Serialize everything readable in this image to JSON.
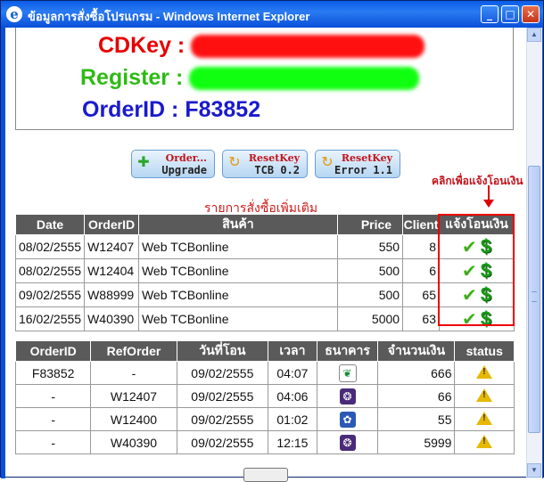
{
  "window": {
    "title": "ข้อมูลการสั่งซื้อโปรแกรม - Windows Internet Explorer"
  },
  "info": {
    "cdkey_label": "CDKey :",
    "register_label": "Register :",
    "orderid_label": "OrderID :",
    "orderid_value": "F83852"
  },
  "buttons": {
    "order_upgrade": {
      "line1": "Order...",
      "line2": "Upgrade"
    },
    "reset_tcb": {
      "line1": "ResetKey",
      "line2": "TCB 0.2"
    },
    "reset_error": {
      "line1": "ResetKey",
      "line2": "Error 1.1"
    }
  },
  "orders": {
    "title": "รายการสั่งซื้อเพิ่มเติม",
    "hint": "คลิกเพื่อแจ้งโอนเงิน",
    "headers": [
      "Date",
      "OrderID",
      "สินค้า",
      "Price",
      "Client",
      "แจ้งโอนเงิน"
    ],
    "rows": [
      {
        "date": "08/02/2555",
        "orderid": "W12407",
        "product": "Web TCBonline",
        "price": "550",
        "client": "8"
      },
      {
        "date": "08/02/2555",
        "orderid": "W12404",
        "product": "Web TCBonline",
        "price": "500",
        "client": "6"
      },
      {
        "date": "09/02/2555",
        "orderid": "W88999",
        "product": "Web TCBonline",
        "price": "500",
        "client": "65"
      },
      {
        "date": "16/02/2555",
        "orderid": "W40390",
        "product": "Web TCBonline",
        "price": "5000",
        "client": "63"
      }
    ]
  },
  "transfers": {
    "headers": [
      "OrderID",
      "RefOrder",
      "วันที่โอน",
      "เวลา",
      "ธนาคาร",
      "จำนวนเงิน",
      "status"
    ],
    "rows": [
      {
        "orderid": "F83852",
        "ref": "-",
        "date": "09/02/2555",
        "time": "04:07",
        "bank": "kbank",
        "amount": "666"
      },
      {
        "orderid": "-",
        "ref": "W12407",
        "date": "09/02/2555",
        "time": "04:06",
        "bank": "scb",
        "amount": "66"
      },
      {
        "orderid": "-",
        "ref": "W12400",
        "date": "09/02/2555",
        "time": "01:02",
        "bank": "ktb",
        "amount": "55"
      },
      {
        "orderid": "-",
        "ref": "W40390",
        "date": "09/02/2555",
        "time": "12:15",
        "bank": "scb",
        "amount": "5999"
      }
    ]
  },
  "colors": {
    "cdkey": "#e60000",
    "register": "#2dbb14",
    "orderid": "#1a1acc",
    "kbank": "#ffffff",
    "scb": "#4a2a7a",
    "ktb": "#2a5ab5"
  }
}
